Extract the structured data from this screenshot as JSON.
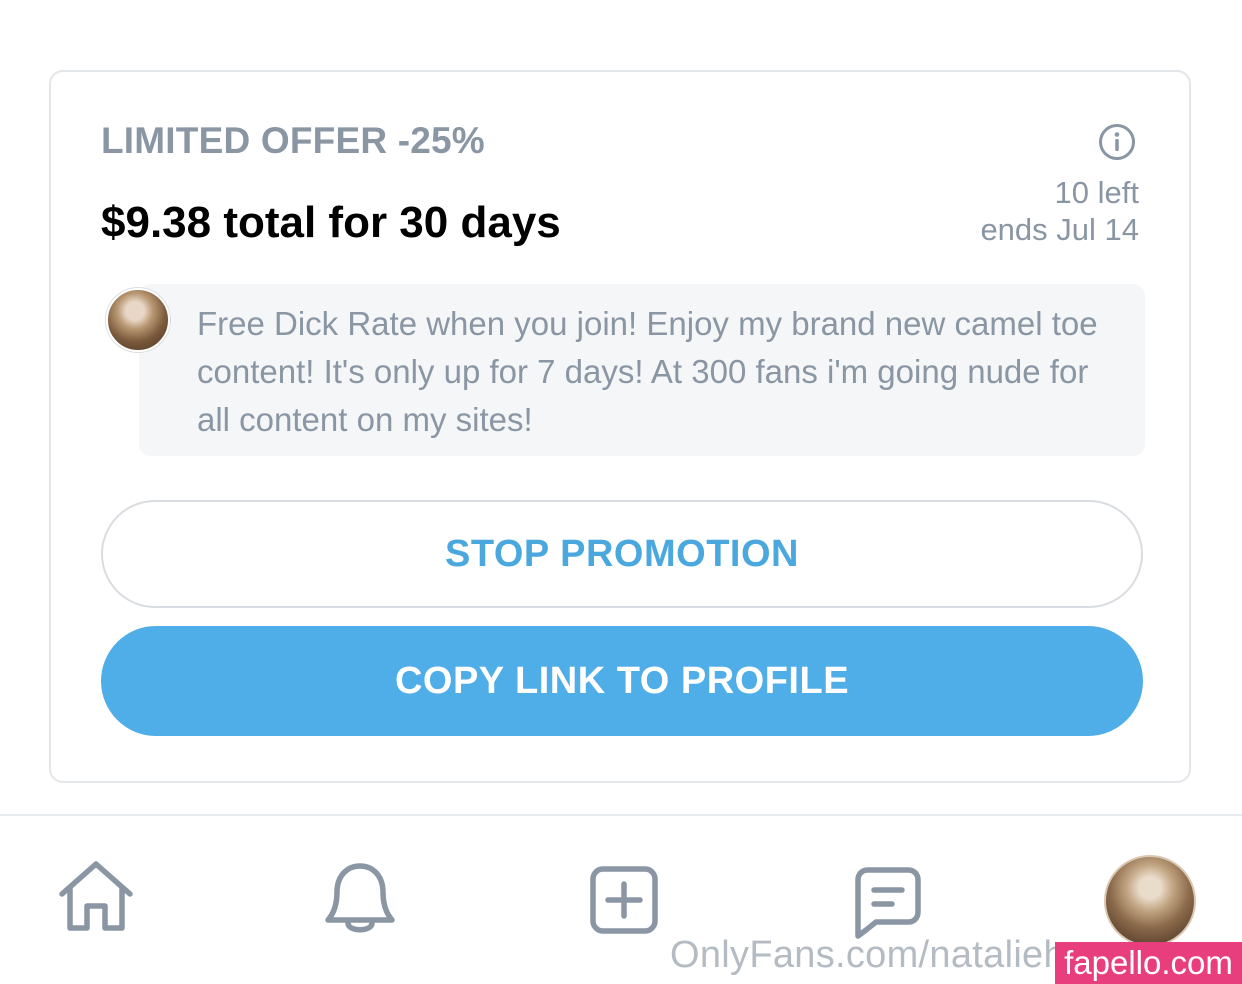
{
  "offer": {
    "title": "LIMITED OFFER -25%",
    "price_line": "$9.38 total for 30 days",
    "remaining": "10 left",
    "ends": "ends Jul 14",
    "message": "Free Dick Rate when you join! Enjoy my brand new camel toe content! It's only up for 7 days! At 300 fans i'm going nude for all content on my sites!"
  },
  "buttons": {
    "stop_label": "STOP PROMOTION",
    "copy_label": "COPY LINK TO PROFILE"
  },
  "nav": {
    "items": [
      "home-icon",
      "bell-icon",
      "plus-square-icon",
      "message-icon",
      "profile-avatar"
    ]
  },
  "watermark": {
    "url_text": "OnlyFans.com/natalieh",
    "brand_text": "fapello.com"
  },
  "colors": {
    "accent": "#4faee8",
    "muted_text": "#8a96a3",
    "brand_badge": "#e83e7d"
  }
}
